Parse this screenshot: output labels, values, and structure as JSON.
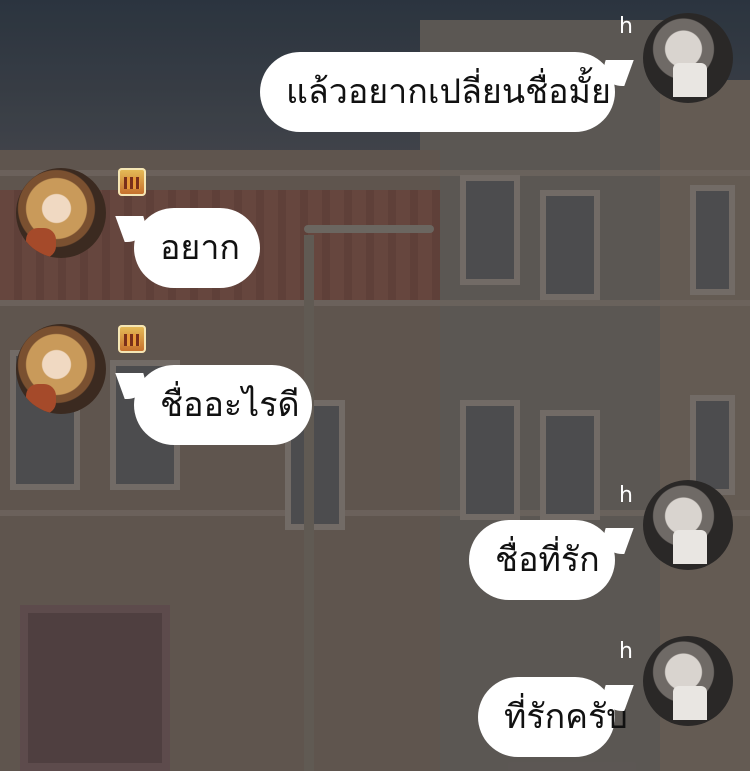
{
  "messages": [
    {
      "side": "right",
      "sender": "h",
      "text": "แล้วอยากเปลี่ยนชื่อมั้ย"
    },
    {
      "side": "left",
      "sender": "",
      "text": "อยาก"
    },
    {
      "side": "left",
      "sender": "",
      "text": "ชื่ออะไรดี"
    },
    {
      "side": "right",
      "sender": "h",
      "text": "ชื่อที่รัก"
    },
    {
      "side": "right",
      "sender": "h",
      "text": "ที่รักครับ"
    }
  ],
  "colors": {
    "bubble": "#ffffff",
    "text": "#111111",
    "sender_label": "#ffffff"
  },
  "icons": {
    "left_badge": "city-sunset-badge-icon"
  }
}
